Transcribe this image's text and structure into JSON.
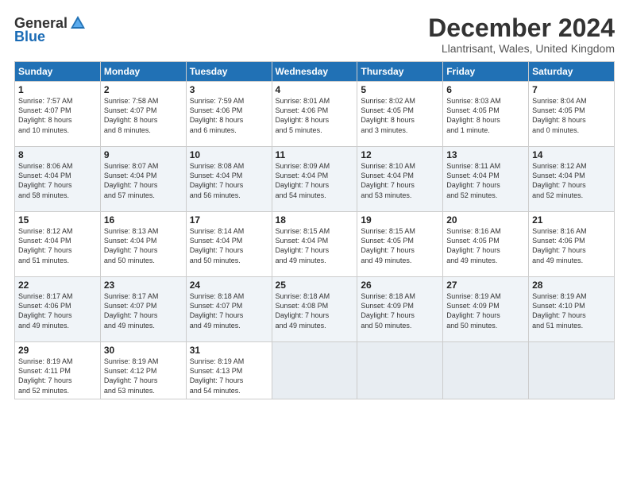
{
  "logo": {
    "general": "General",
    "blue": "Blue"
  },
  "header": {
    "month": "December 2024",
    "location": "Llantrisant, Wales, United Kingdom"
  },
  "weekdays": [
    "Sunday",
    "Monday",
    "Tuesday",
    "Wednesday",
    "Thursday",
    "Friday",
    "Saturday"
  ],
  "weeks": [
    [
      {
        "day": "1",
        "info": "Sunrise: 7:57 AM\nSunset: 4:07 PM\nDaylight: 8 hours\nand 10 minutes."
      },
      {
        "day": "2",
        "info": "Sunrise: 7:58 AM\nSunset: 4:07 PM\nDaylight: 8 hours\nand 8 minutes."
      },
      {
        "day": "3",
        "info": "Sunrise: 7:59 AM\nSunset: 4:06 PM\nDaylight: 8 hours\nand 6 minutes."
      },
      {
        "day": "4",
        "info": "Sunrise: 8:01 AM\nSunset: 4:06 PM\nDaylight: 8 hours\nand 5 minutes."
      },
      {
        "day": "5",
        "info": "Sunrise: 8:02 AM\nSunset: 4:05 PM\nDaylight: 8 hours\nand 3 minutes."
      },
      {
        "day": "6",
        "info": "Sunrise: 8:03 AM\nSunset: 4:05 PM\nDaylight: 8 hours\nand 1 minute."
      },
      {
        "day": "7",
        "info": "Sunrise: 8:04 AM\nSunset: 4:05 PM\nDaylight: 8 hours\nand 0 minutes."
      }
    ],
    [
      {
        "day": "8",
        "info": "Sunrise: 8:06 AM\nSunset: 4:04 PM\nDaylight: 7 hours\nand 58 minutes."
      },
      {
        "day": "9",
        "info": "Sunrise: 8:07 AM\nSunset: 4:04 PM\nDaylight: 7 hours\nand 57 minutes."
      },
      {
        "day": "10",
        "info": "Sunrise: 8:08 AM\nSunset: 4:04 PM\nDaylight: 7 hours\nand 56 minutes."
      },
      {
        "day": "11",
        "info": "Sunrise: 8:09 AM\nSunset: 4:04 PM\nDaylight: 7 hours\nand 54 minutes."
      },
      {
        "day": "12",
        "info": "Sunrise: 8:10 AM\nSunset: 4:04 PM\nDaylight: 7 hours\nand 53 minutes."
      },
      {
        "day": "13",
        "info": "Sunrise: 8:11 AM\nSunset: 4:04 PM\nDaylight: 7 hours\nand 52 minutes."
      },
      {
        "day": "14",
        "info": "Sunrise: 8:12 AM\nSunset: 4:04 PM\nDaylight: 7 hours\nand 52 minutes."
      }
    ],
    [
      {
        "day": "15",
        "info": "Sunrise: 8:12 AM\nSunset: 4:04 PM\nDaylight: 7 hours\nand 51 minutes."
      },
      {
        "day": "16",
        "info": "Sunrise: 8:13 AM\nSunset: 4:04 PM\nDaylight: 7 hours\nand 50 minutes."
      },
      {
        "day": "17",
        "info": "Sunrise: 8:14 AM\nSunset: 4:04 PM\nDaylight: 7 hours\nand 50 minutes."
      },
      {
        "day": "18",
        "info": "Sunrise: 8:15 AM\nSunset: 4:04 PM\nDaylight: 7 hours\nand 49 minutes."
      },
      {
        "day": "19",
        "info": "Sunrise: 8:15 AM\nSunset: 4:05 PM\nDaylight: 7 hours\nand 49 minutes."
      },
      {
        "day": "20",
        "info": "Sunrise: 8:16 AM\nSunset: 4:05 PM\nDaylight: 7 hours\nand 49 minutes."
      },
      {
        "day": "21",
        "info": "Sunrise: 8:16 AM\nSunset: 4:06 PM\nDaylight: 7 hours\nand 49 minutes."
      }
    ],
    [
      {
        "day": "22",
        "info": "Sunrise: 8:17 AM\nSunset: 4:06 PM\nDaylight: 7 hours\nand 49 minutes."
      },
      {
        "day": "23",
        "info": "Sunrise: 8:17 AM\nSunset: 4:07 PM\nDaylight: 7 hours\nand 49 minutes."
      },
      {
        "day": "24",
        "info": "Sunrise: 8:18 AM\nSunset: 4:07 PM\nDaylight: 7 hours\nand 49 minutes."
      },
      {
        "day": "25",
        "info": "Sunrise: 8:18 AM\nSunset: 4:08 PM\nDaylight: 7 hours\nand 49 minutes."
      },
      {
        "day": "26",
        "info": "Sunrise: 8:18 AM\nSunset: 4:09 PM\nDaylight: 7 hours\nand 50 minutes."
      },
      {
        "day": "27",
        "info": "Sunrise: 8:19 AM\nSunset: 4:09 PM\nDaylight: 7 hours\nand 50 minutes."
      },
      {
        "day": "28",
        "info": "Sunrise: 8:19 AM\nSunset: 4:10 PM\nDaylight: 7 hours\nand 51 minutes."
      }
    ],
    [
      {
        "day": "29",
        "info": "Sunrise: 8:19 AM\nSunset: 4:11 PM\nDaylight: 7 hours\nand 52 minutes."
      },
      {
        "day": "30",
        "info": "Sunrise: 8:19 AM\nSunset: 4:12 PM\nDaylight: 7 hours\nand 53 minutes."
      },
      {
        "day": "31",
        "info": "Sunrise: 8:19 AM\nSunset: 4:13 PM\nDaylight: 7 hours\nand 54 minutes."
      },
      {
        "day": "",
        "info": ""
      },
      {
        "day": "",
        "info": ""
      },
      {
        "day": "",
        "info": ""
      },
      {
        "day": "",
        "info": ""
      }
    ]
  ]
}
